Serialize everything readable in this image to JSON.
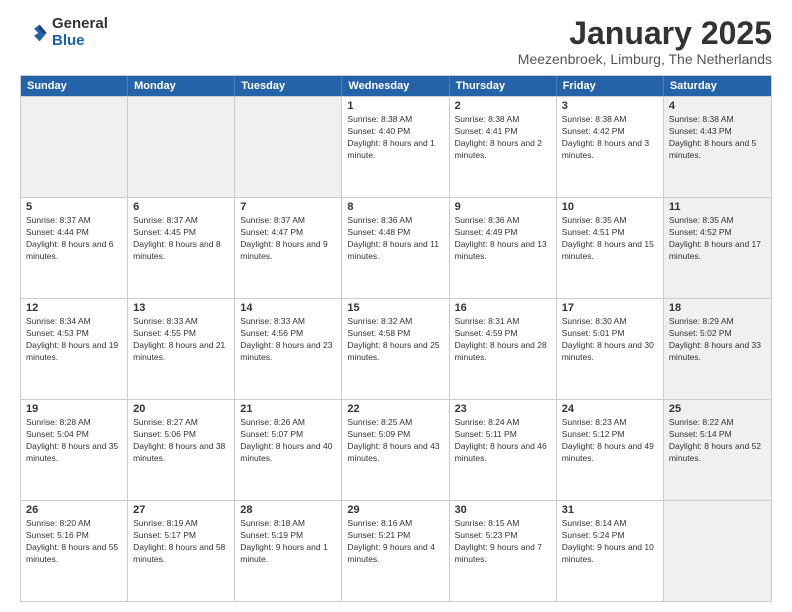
{
  "logo": {
    "general": "General",
    "blue": "Blue"
  },
  "header": {
    "month": "January 2025",
    "location": "Meezenbroek, Limburg, The Netherlands"
  },
  "weekdays": [
    "Sunday",
    "Monday",
    "Tuesday",
    "Wednesday",
    "Thursday",
    "Friday",
    "Saturday"
  ],
  "weeks": [
    [
      {
        "day": "",
        "sunrise": "",
        "sunset": "",
        "daylight": "",
        "shaded": true
      },
      {
        "day": "",
        "sunrise": "",
        "sunset": "",
        "daylight": "",
        "shaded": true
      },
      {
        "day": "",
        "sunrise": "",
        "sunset": "",
        "daylight": "",
        "shaded": true
      },
      {
        "day": "1",
        "sunrise": "Sunrise: 8:38 AM",
        "sunset": "Sunset: 4:40 PM",
        "daylight": "Daylight: 8 hours and 1 minute.",
        "shaded": false
      },
      {
        "day": "2",
        "sunrise": "Sunrise: 8:38 AM",
        "sunset": "Sunset: 4:41 PM",
        "daylight": "Daylight: 8 hours and 2 minutes.",
        "shaded": false
      },
      {
        "day": "3",
        "sunrise": "Sunrise: 8:38 AM",
        "sunset": "Sunset: 4:42 PM",
        "daylight": "Daylight: 8 hours and 3 minutes.",
        "shaded": false
      },
      {
        "day": "4",
        "sunrise": "Sunrise: 8:38 AM",
        "sunset": "Sunset: 4:43 PM",
        "daylight": "Daylight: 8 hours and 5 minutes.",
        "shaded": true
      }
    ],
    [
      {
        "day": "5",
        "sunrise": "Sunrise: 8:37 AM",
        "sunset": "Sunset: 4:44 PM",
        "daylight": "Daylight: 8 hours and 6 minutes.",
        "shaded": false
      },
      {
        "day": "6",
        "sunrise": "Sunrise: 8:37 AM",
        "sunset": "Sunset: 4:45 PM",
        "daylight": "Daylight: 8 hours and 8 minutes.",
        "shaded": false
      },
      {
        "day": "7",
        "sunrise": "Sunrise: 8:37 AM",
        "sunset": "Sunset: 4:47 PM",
        "daylight": "Daylight: 8 hours and 9 minutes.",
        "shaded": false
      },
      {
        "day": "8",
        "sunrise": "Sunrise: 8:36 AM",
        "sunset": "Sunset: 4:48 PM",
        "daylight": "Daylight: 8 hours and 11 minutes.",
        "shaded": false
      },
      {
        "day": "9",
        "sunrise": "Sunrise: 8:36 AM",
        "sunset": "Sunset: 4:49 PM",
        "daylight": "Daylight: 8 hours and 13 minutes.",
        "shaded": false
      },
      {
        "day": "10",
        "sunrise": "Sunrise: 8:35 AM",
        "sunset": "Sunset: 4:51 PM",
        "daylight": "Daylight: 8 hours and 15 minutes.",
        "shaded": false
      },
      {
        "day": "11",
        "sunrise": "Sunrise: 8:35 AM",
        "sunset": "Sunset: 4:52 PM",
        "daylight": "Daylight: 8 hours and 17 minutes.",
        "shaded": true
      }
    ],
    [
      {
        "day": "12",
        "sunrise": "Sunrise: 8:34 AM",
        "sunset": "Sunset: 4:53 PM",
        "daylight": "Daylight: 8 hours and 19 minutes.",
        "shaded": false
      },
      {
        "day": "13",
        "sunrise": "Sunrise: 8:33 AM",
        "sunset": "Sunset: 4:55 PM",
        "daylight": "Daylight: 8 hours and 21 minutes.",
        "shaded": false
      },
      {
        "day": "14",
        "sunrise": "Sunrise: 8:33 AM",
        "sunset": "Sunset: 4:56 PM",
        "daylight": "Daylight: 8 hours and 23 minutes.",
        "shaded": false
      },
      {
        "day": "15",
        "sunrise": "Sunrise: 8:32 AM",
        "sunset": "Sunset: 4:58 PM",
        "daylight": "Daylight: 8 hours and 25 minutes.",
        "shaded": false
      },
      {
        "day": "16",
        "sunrise": "Sunrise: 8:31 AM",
        "sunset": "Sunset: 4:59 PM",
        "daylight": "Daylight: 8 hours and 28 minutes.",
        "shaded": false
      },
      {
        "day": "17",
        "sunrise": "Sunrise: 8:30 AM",
        "sunset": "Sunset: 5:01 PM",
        "daylight": "Daylight: 8 hours and 30 minutes.",
        "shaded": false
      },
      {
        "day": "18",
        "sunrise": "Sunrise: 8:29 AM",
        "sunset": "Sunset: 5:02 PM",
        "daylight": "Daylight: 8 hours and 33 minutes.",
        "shaded": true
      }
    ],
    [
      {
        "day": "19",
        "sunrise": "Sunrise: 8:28 AM",
        "sunset": "Sunset: 5:04 PM",
        "daylight": "Daylight: 8 hours and 35 minutes.",
        "shaded": false
      },
      {
        "day": "20",
        "sunrise": "Sunrise: 8:27 AM",
        "sunset": "Sunset: 5:06 PM",
        "daylight": "Daylight: 8 hours and 38 minutes.",
        "shaded": false
      },
      {
        "day": "21",
        "sunrise": "Sunrise: 8:26 AM",
        "sunset": "Sunset: 5:07 PM",
        "daylight": "Daylight: 8 hours and 40 minutes.",
        "shaded": false
      },
      {
        "day": "22",
        "sunrise": "Sunrise: 8:25 AM",
        "sunset": "Sunset: 5:09 PM",
        "daylight": "Daylight: 8 hours and 43 minutes.",
        "shaded": false
      },
      {
        "day": "23",
        "sunrise": "Sunrise: 8:24 AM",
        "sunset": "Sunset: 5:11 PM",
        "daylight": "Daylight: 8 hours and 46 minutes.",
        "shaded": false
      },
      {
        "day": "24",
        "sunrise": "Sunrise: 8:23 AM",
        "sunset": "Sunset: 5:12 PM",
        "daylight": "Daylight: 8 hours and 49 minutes.",
        "shaded": false
      },
      {
        "day": "25",
        "sunrise": "Sunrise: 8:22 AM",
        "sunset": "Sunset: 5:14 PM",
        "daylight": "Daylight: 8 hours and 52 minutes.",
        "shaded": true
      }
    ],
    [
      {
        "day": "26",
        "sunrise": "Sunrise: 8:20 AM",
        "sunset": "Sunset: 5:16 PM",
        "daylight": "Daylight: 8 hours and 55 minutes.",
        "shaded": false
      },
      {
        "day": "27",
        "sunrise": "Sunrise: 8:19 AM",
        "sunset": "Sunset: 5:17 PM",
        "daylight": "Daylight: 8 hours and 58 minutes.",
        "shaded": false
      },
      {
        "day": "28",
        "sunrise": "Sunrise: 8:18 AM",
        "sunset": "Sunset: 5:19 PM",
        "daylight": "Daylight: 9 hours and 1 minute.",
        "shaded": false
      },
      {
        "day": "29",
        "sunrise": "Sunrise: 8:16 AM",
        "sunset": "Sunset: 5:21 PM",
        "daylight": "Daylight: 9 hours and 4 minutes.",
        "shaded": false
      },
      {
        "day": "30",
        "sunrise": "Sunrise: 8:15 AM",
        "sunset": "Sunset: 5:23 PM",
        "daylight": "Daylight: 9 hours and 7 minutes.",
        "shaded": false
      },
      {
        "day": "31",
        "sunrise": "Sunrise: 8:14 AM",
        "sunset": "Sunset: 5:24 PM",
        "daylight": "Daylight: 9 hours and 10 minutes.",
        "shaded": false
      },
      {
        "day": "",
        "sunrise": "",
        "sunset": "",
        "daylight": "",
        "shaded": true
      }
    ]
  ]
}
